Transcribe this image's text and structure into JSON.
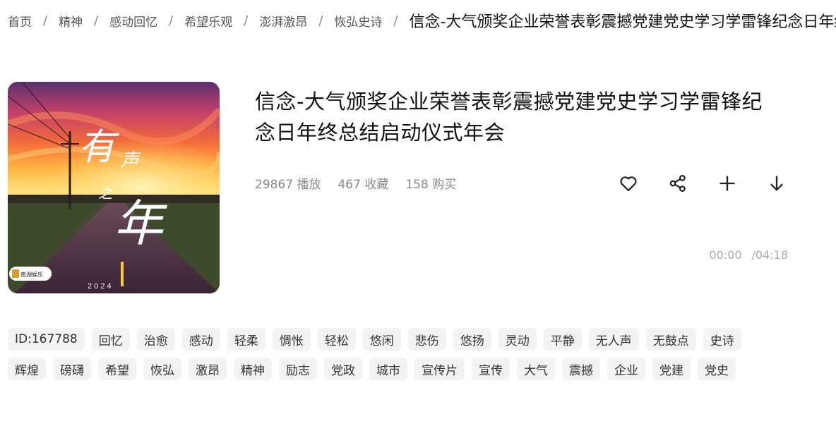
{
  "breadcrumb": {
    "items": [
      "首页",
      "精神",
      "感动回忆",
      "希望乐观",
      "澎湃激昂",
      "恢弘史诗"
    ],
    "separator": "/",
    "current": "信念-大气颁奖企业荣誉表彰震撼党建党史学习学雷锋纪念日年终总结启动仪式年会"
  },
  "track": {
    "title": "信念-大气颁奖企业荣誉表彰震撼党建党史学习学雷锋纪念日年终总结启动仪式年会",
    "cover": {
      "calligraphy": [
        "有",
        "声",
        "之",
        "年"
      ],
      "year": "2 0 2 4",
      "badge": "南湖娱乐"
    },
    "stats": {
      "plays": "29867 播放",
      "favorites": "467 收藏",
      "purchases": "158 购买"
    },
    "time": {
      "current": "00:00",
      "total": "/04:18"
    },
    "actions": [
      "heart-icon",
      "share-icon",
      "plus-icon",
      "download-icon"
    ]
  },
  "tags": [
    "ID:167788",
    "回忆",
    "治愈",
    "感动",
    "轻柔",
    "惆怅",
    "轻松",
    "悠闲",
    "悲伤",
    "悠扬",
    "灵动",
    "平静",
    "无人声",
    "无鼓点",
    "史诗",
    "辉煌",
    "磅礴",
    "希望",
    "恢弘",
    "激昂",
    "精神",
    "励志",
    "党政",
    "城市",
    "宣传片",
    "宣传",
    "大气",
    "震撼",
    "企业",
    "党建",
    "党史"
  ],
  "colors": {
    "tag_bg": "#f3f3f3",
    "muted_text": "#888888",
    "title_text": "#111111"
  }
}
